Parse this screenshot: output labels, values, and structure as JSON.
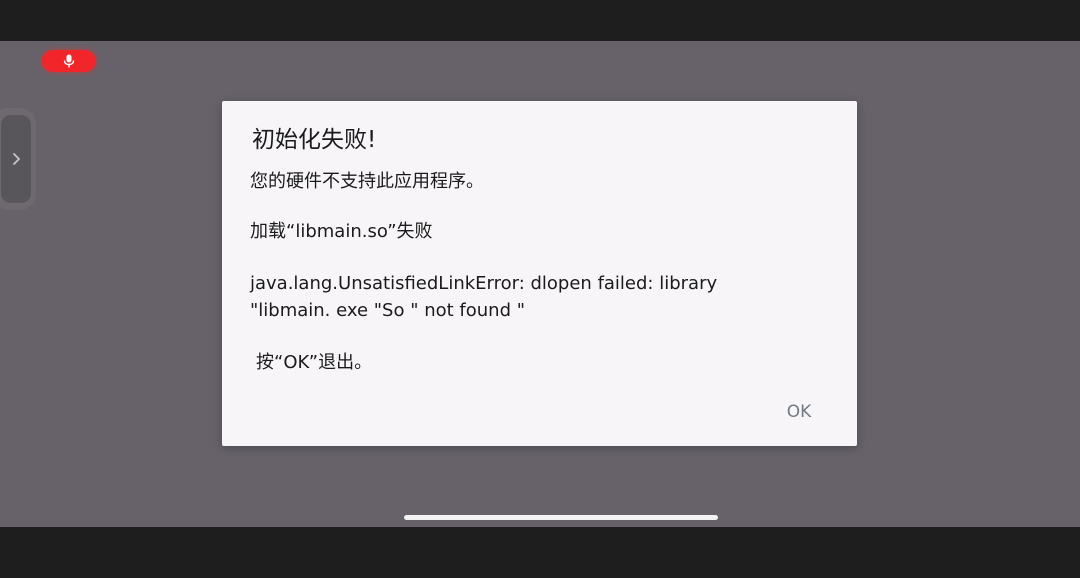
{
  "colors": {
    "screen_background": "#67626a",
    "dialog_background": "#f7f5f8",
    "ok_button_text": "#6f7a87",
    "mic_indicator": "#f0262a"
  },
  "status": {
    "mic_icon": "microphone-icon"
  },
  "side_handle": {
    "icon": "chevron-right-icon"
  },
  "dialog": {
    "title": "初始化失败!",
    "message_line_1": "您的硬件不支持此应用程序。",
    "message_line_2": "加载“libmain.so”失败",
    "message_line_3": "java.lang.UnsatisfiedLinkError: dlopen failed: library",
    "message_line_4": "\"libmain. exe \"So \" not found \"",
    "message_line_5": "按“OK”退出。",
    "ok_label": "OK"
  }
}
